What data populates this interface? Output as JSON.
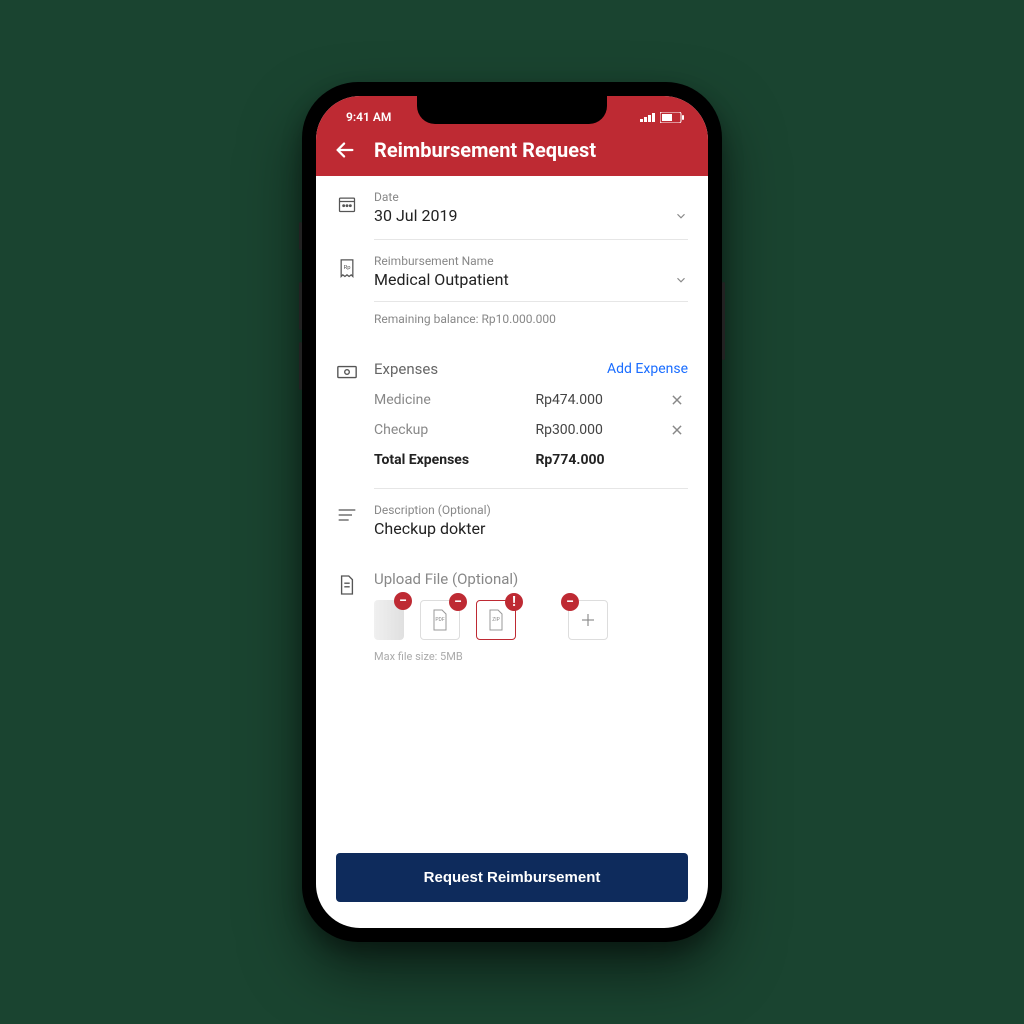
{
  "status": {
    "time": "9:41 AM"
  },
  "header": {
    "title": "Reimbursement Request"
  },
  "date": {
    "label": "Date",
    "value": "30 Jul 2019"
  },
  "name": {
    "label": "Reimbursement Name",
    "value": "Medical Outpatient",
    "helper": "Remaining balance: Rp10.000.000"
  },
  "expenses": {
    "title": "Expenses",
    "add_label": "Add Expense",
    "items": [
      {
        "name": "Medicine",
        "amount": "Rp474.000"
      },
      {
        "name": "Checkup",
        "amount": "Rp300.000"
      }
    ],
    "total_label": "Total Expenses",
    "total_amount": "Rp774.000"
  },
  "description": {
    "label": "Description (Optional)",
    "value": "Checkup dokter"
  },
  "upload": {
    "label": "Upload File (Optional)",
    "thumb_labels": {
      "pdf": "PDF",
      "zip": "ZIP"
    },
    "max_size": "Max file size: 5MB"
  },
  "submit": {
    "label": "Request Reimbursement"
  }
}
